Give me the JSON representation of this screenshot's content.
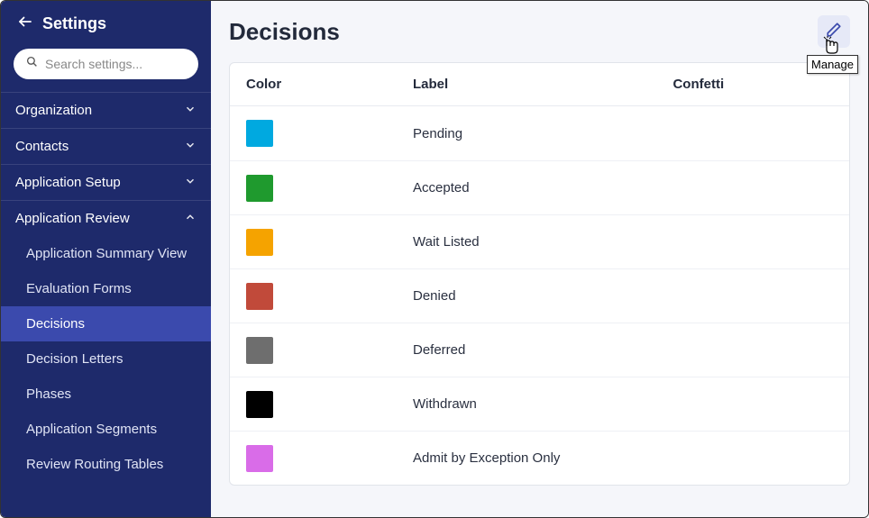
{
  "sidebar": {
    "title": "Settings",
    "searchPlaceholder": "Search settings...",
    "groups": [
      {
        "label": "Organization",
        "expanded": false
      },
      {
        "label": "Contacts",
        "expanded": false
      },
      {
        "label": "Application Setup",
        "expanded": false
      },
      {
        "label": "Application Review",
        "expanded": true
      }
    ],
    "appReviewItems": [
      {
        "label": "Application Summary View",
        "active": false
      },
      {
        "label": "Evaluation Forms",
        "active": false
      },
      {
        "label": "Decisions",
        "active": true
      },
      {
        "label": "Decision Letters",
        "active": false
      },
      {
        "label": "Phases",
        "active": false
      },
      {
        "label": "Application Segments",
        "active": false
      },
      {
        "label": "Review Routing Tables",
        "active": false
      }
    ]
  },
  "main": {
    "title": "Decisions",
    "tooltip": "Manage",
    "columns": {
      "color": "Color",
      "label": "Label",
      "confetti": "Confetti"
    },
    "rows": [
      {
        "color": "#00a9e0",
        "label": "Pending",
        "confetti": ""
      },
      {
        "color": "#1f9a2e",
        "label": "Accepted",
        "confetti": ""
      },
      {
        "color": "#f5a300",
        "label": "Wait Listed",
        "confetti": ""
      },
      {
        "color": "#c14a3a",
        "label": "Denied",
        "confetti": ""
      },
      {
        "color": "#6e6e6e",
        "label": "Deferred",
        "confetti": ""
      },
      {
        "color": "#000000",
        "label": "Withdrawn",
        "confetti": ""
      },
      {
        "color": "#d96ce8",
        "label": "Admit by Exception Only",
        "confetti": ""
      }
    ]
  }
}
